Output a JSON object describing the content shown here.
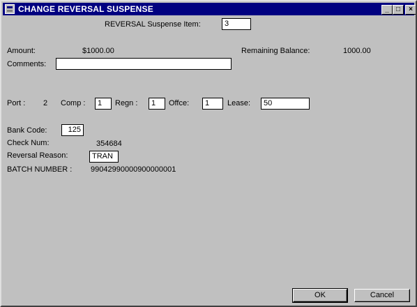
{
  "window": {
    "title": "CHANGE REVERSAL SUSPENSE",
    "min_glyph": "_",
    "max_glyph": "□",
    "close_glyph": "×"
  },
  "header": {
    "suspense_label": "REVERSAL  Suspense Item:",
    "suspense_value": "3"
  },
  "amount": {
    "label": "Amount:",
    "value": "$1000.00",
    "remaining_label": "Remaining Balance:",
    "remaining_value": "1000.00"
  },
  "comments": {
    "label": "Comments:",
    "value": ""
  },
  "location": {
    "port_label": "Port :",
    "port_value": "2",
    "comp_label": "Comp :",
    "comp_value": "1",
    "regn_label": "Regn :",
    "regn_value": "1",
    "offce_label": "Offce:",
    "offce_value": "1",
    "lease_label": "Lease:",
    "lease_value": "50"
  },
  "bank": {
    "code_label": "Bank Code:",
    "code_value": "125",
    "check_label": "Check Num:",
    "check_value": "354684",
    "reason_label": "Reversal Reason:",
    "reason_value": "TRAN",
    "batch_label": "BATCH NUMBER   :",
    "batch_value": "99042990000900000001"
  },
  "buttons": {
    "ok": "OK",
    "cancel": "Cancel"
  }
}
